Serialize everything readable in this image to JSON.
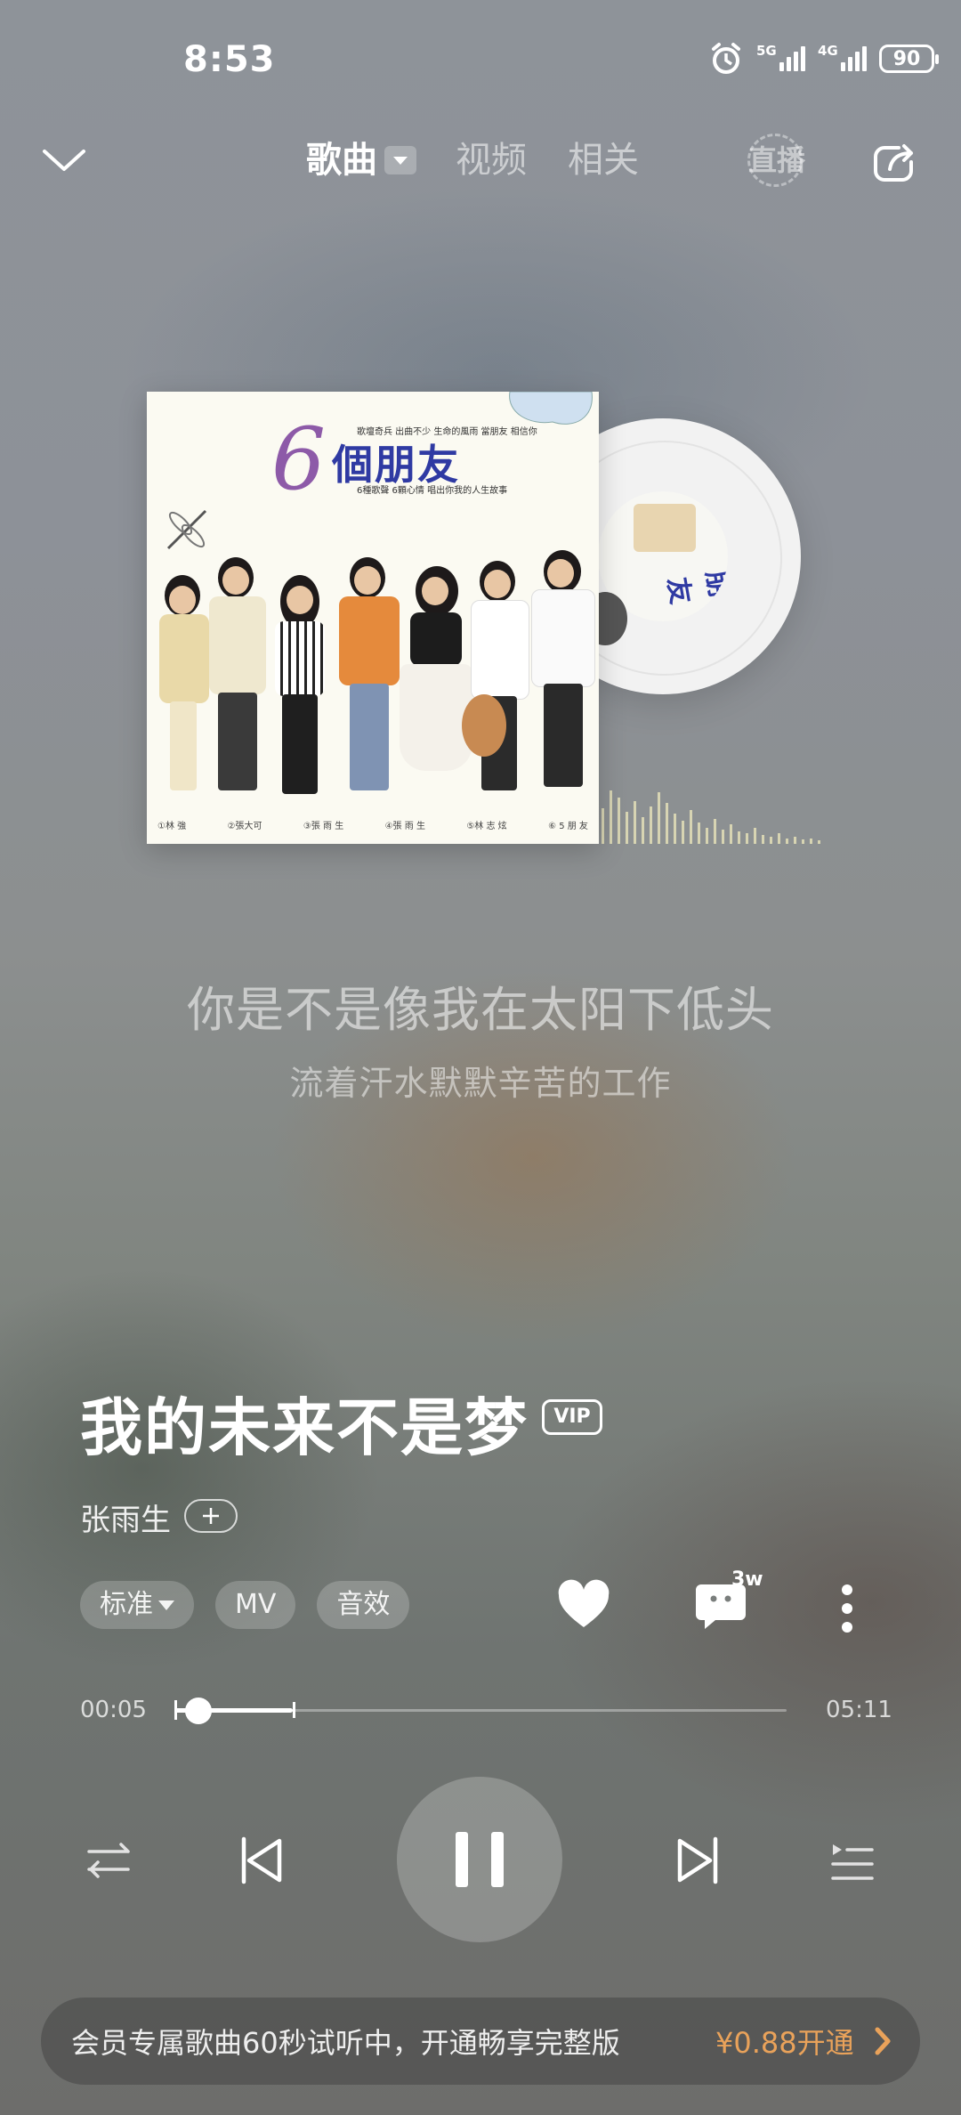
{
  "status_bar": {
    "time": "8:53",
    "network1": "5G",
    "network2": "4G",
    "battery": "90"
  },
  "header": {
    "tabs": [
      {
        "label": "歌曲"
      },
      {
        "label": "视频"
      },
      {
        "label": "相关"
      }
    ],
    "live_label": "直播"
  },
  "album": {
    "cover_title": "個朋友",
    "cover_number": "6",
    "cover_tagline_1": "歌壇奇兵 出曲不少 生命的風雨 當朋友 相信你",
    "cover_tagline_2": "6種歌聲 6顆心情 唱出你我的人生故事",
    "cover_names": [
      "①林 強",
      "②張大可",
      "③張 雨 生",
      "④張 雨 生",
      "⑤林 志 炫",
      "⑥ 5 朋 友"
    ]
  },
  "lyrics": {
    "current": "你是不是像我在太阳下低头",
    "next": "流着汗水默默辛苦的工作"
  },
  "song": {
    "title": "我的未来不是梦",
    "vip_badge": "VIP",
    "artist": "张雨生"
  },
  "chips": {
    "quality": "标准",
    "mv": "MV",
    "effect": "音效"
  },
  "actions": {
    "comment_count": "3w"
  },
  "progress": {
    "current": "00:05",
    "total": "05:11",
    "played_fraction": 0.016,
    "trial_fraction": 0.193
  },
  "banner": {
    "text": "会员专属歌曲60秒试听中，开通畅享完整版",
    "cta": "¥0.88开通"
  },
  "colors": {
    "accent": "#e9a25a",
    "album_title": "#2f3aa3"
  }
}
